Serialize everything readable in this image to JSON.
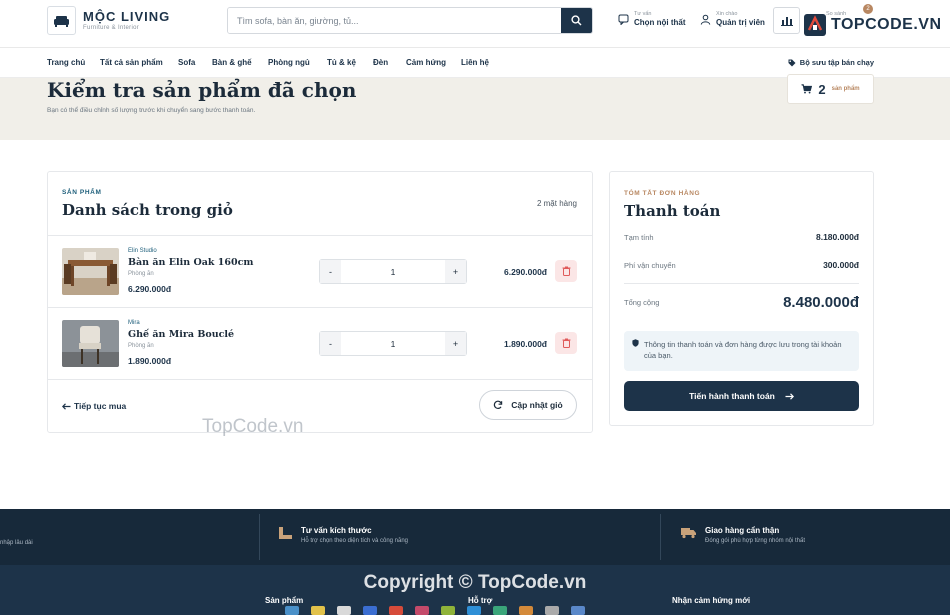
{
  "header": {
    "logo_title": "MỘC LIVING",
    "logo_subtitle": "Furniture & Interior",
    "search_placeholder": "Tìm sofa, bàn ăn, giường, tủ...",
    "advise_small": "Tư vấn",
    "advise_big": "Chọn nội thất",
    "admin_small": "Xin chào",
    "admin_big": "Quản trị viên",
    "cart_badge": "2",
    "compare_small": "So sánh",
    "brand_mark": "TOPCODE.VN"
  },
  "nav": {
    "items": [
      "Trang chủ",
      "Tất cả sản phẩm",
      "Sofa",
      "Bàn & ghế",
      "Phòng ngủ",
      "Tủ & kệ",
      "Đèn",
      "Cảm hứng",
      "Liên hệ"
    ],
    "right": "Bộ sưu tập bán chạy"
  },
  "hero": {
    "title": "Kiểm tra sản phẩm đã chọn",
    "subtitle": "Bạn có thể điều chỉnh số lượng trước khi chuyển sang bước thanh toán.",
    "count": "2",
    "count_unit": "sản phẩm"
  },
  "cart": {
    "eyebrow": "SẢN PHẨM",
    "title": "Danh sách trong giỏ",
    "count_label": "2 mặt hàng",
    "items": [
      {
        "brand": "Elin Studio",
        "name": "Bàn ăn Elin Oak 160cm",
        "room": "Phòng ăn",
        "price": "6.290.000đ",
        "qty": "1",
        "total": "6.290.000đ"
      },
      {
        "brand": "Mira",
        "name": "Ghế ăn Mira Bouclé",
        "room": "Phòng ăn",
        "price": "1.890.000đ",
        "qty": "1",
        "total": "1.890.000đ"
      }
    ],
    "continue_label": "Tiếp tục mua",
    "update_label": "Cập nhật giỏ"
  },
  "summary": {
    "eyebrow": "TÓM TẮT ĐƠN HÀNG",
    "title": "Thanh toán",
    "subtotal_label": "Tạm tính",
    "subtotal": "8.180.000đ",
    "shipping_label": "Phí vận chuyển",
    "shipping": "300.000đ",
    "total_label": "Tổng cộng",
    "total": "8.480.000đ",
    "notice": "Thông tin thanh toán và đơn hàng được lưu trong tài khoản của bạn.",
    "checkout_label": "Tiến hành thanh toán"
  },
  "footer": {
    "left_fragment": "nhập lâu dài",
    "features": [
      {
        "title": "Tư vấn kích thước",
        "desc": "Hỗ trợ chọn theo diện tích và công năng"
      },
      {
        "title": "Giao hàng cẩn thận",
        "desc": "Đóng gói phù hợp từng nhóm nội thất"
      }
    ],
    "columns": [
      "Sản phẩm",
      "Hỗ trợ",
      "Nhận cảm hứng mới"
    ],
    "copyright": "Copyright © TopCode.vn"
  },
  "watermark": "TopCode.vn",
  "colors": {
    "primary": "#1d3349",
    "accent": "#b88761",
    "danger_bg": "#fbe6e6",
    "hero_bg": "#f1efe9"
  }
}
